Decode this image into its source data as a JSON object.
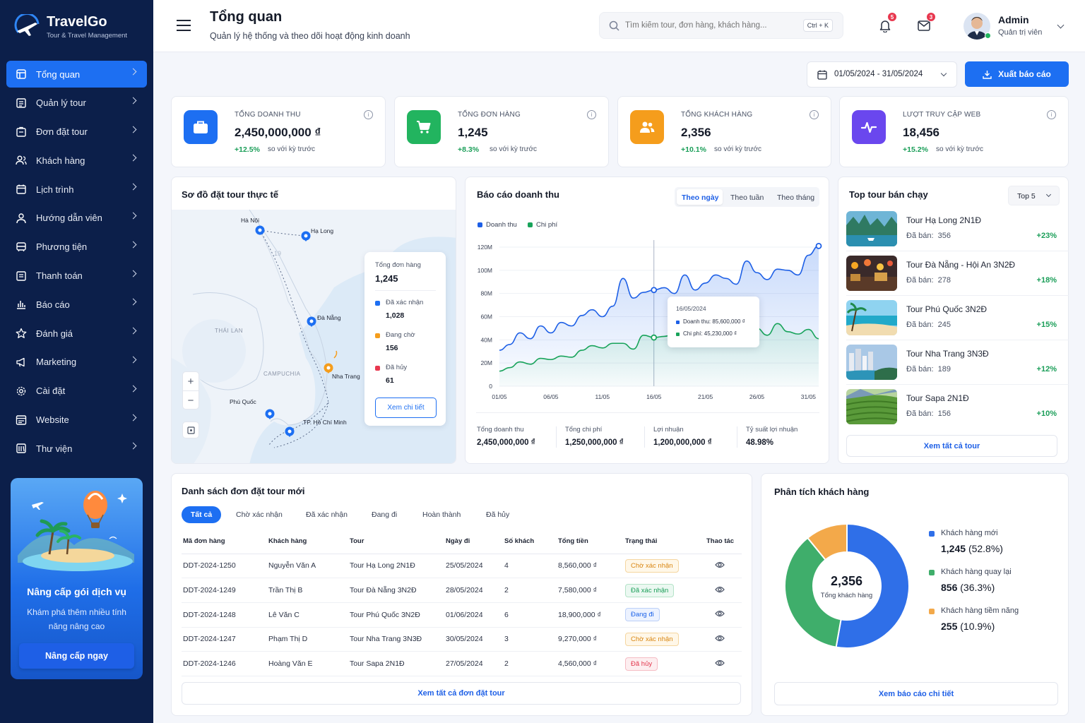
{
  "app": {
    "name": "TravelGo",
    "subtitle": "Tour & Travel Management"
  },
  "sidebar": {
    "items": [
      {
        "label": "Tổng quan",
        "icon": "dashboard-icon"
      },
      {
        "label": "Quản lý tour",
        "icon": "tour-list-icon"
      },
      {
        "label": "Đơn đặt tour",
        "icon": "booking-icon"
      },
      {
        "label": "Khách hàng",
        "icon": "customers-icon"
      },
      {
        "label": "Lịch trình",
        "icon": "calendar-icon"
      },
      {
        "label": "Hướng dẫn viên",
        "icon": "guide-icon"
      },
      {
        "label": "Phương tiện",
        "icon": "bus-icon"
      },
      {
        "label": "Thanh toán",
        "icon": "payment-icon"
      },
      {
        "label": "Báo cáo",
        "icon": "report-icon"
      },
      {
        "label": "Đánh giá",
        "icon": "star-icon"
      },
      {
        "label": "Marketing",
        "icon": "megaphone-icon"
      },
      {
        "label": "Cài đặt",
        "icon": "gear-icon"
      },
      {
        "label": "Website",
        "icon": "website-icon"
      },
      {
        "label": "Thư viện",
        "icon": "library-icon"
      }
    ],
    "promo": {
      "title": "Nâng cấp gói dịch vụ",
      "text": "Khám phá thêm nhiều tính năng nâng cao",
      "button": "Nâng cấp ngay"
    }
  },
  "header": {
    "title": "Tổng quan",
    "subtitle": "Quản lý hệ thống và theo dõi hoạt động kinh doanh",
    "search_placeholder": "Tìm kiếm tour, đơn hàng, khách hàng...",
    "shortcut": "Ctrl + K",
    "notif_count": "5",
    "mail_count": "3",
    "user_name": "Admin",
    "user_role": "Quản trị viên"
  },
  "toolbar": {
    "date_range": "01/05/2024 - 31/05/2024",
    "export_label": "Xuất báo cáo"
  },
  "stats": [
    {
      "label": "TỔNG DOANH THU",
      "value": "2,450,000,000 ₫",
      "change": "+12.5%",
      "note": "so với kỳ trước",
      "color": "#1d6ff2"
    },
    {
      "label": "TỔNG ĐƠN HÀNG",
      "value": "1,245",
      "change": "+8.3%",
      "note": "so với kỳ trước",
      "color": "#22b45f"
    },
    {
      "label": "TỔNG KHÁCH HÀNG",
      "value": "2,356",
      "change": "+10.1%",
      "note": "so với kỳ trước",
      "color": "#f59d1c"
    },
    {
      "label": "LƯỢT TRUY CẬP WEB",
      "value": "18,456",
      "change": "+15.2%",
      "note": "so với kỳ trước",
      "color": "#6a47ee"
    }
  ],
  "map": {
    "title": "Sơ đồ đặt tour thực tế",
    "places": {
      "hanoi": "Hà Nội",
      "halong": "Hạ Long",
      "danang": "Đà Nẵng",
      "nhatrang": "Nha Trang",
      "phuquoc": "Phú Quốc",
      "hcm": "TP. Hồ Chí Minh",
      "thailan": "THÁI LAN",
      "campuchia": "CAMPUCHIA"
    },
    "summary": {
      "total_label": "Tổng đơn hàng",
      "total": "1,245",
      "items": [
        {
          "label": "Đã xác nhận",
          "value": "1,028",
          "color": "#1d6ff2"
        },
        {
          "label": "Đang chờ",
          "value": "156",
          "color": "#f59d1c"
        },
        {
          "label": "Đã hủy",
          "value": "61",
          "color": "#e8384f"
        }
      ],
      "button": "Xem chi tiết"
    }
  },
  "revenue": {
    "title": "Báo cáo doanh thu",
    "tabs": [
      "Theo ngày",
      "Theo tuần",
      "Theo tháng"
    ],
    "legend": [
      "Doanh thu",
      "Chi phí"
    ],
    "tooltip": {
      "date": "16/05/2024",
      "revenue": "Doanh thu: 85,600,000 ₫",
      "cost": "Chi phí: 45,230,000 ₫"
    },
    "totals": [
      {
        "label": "Tổng doanh thu",
        "value": "2,450,000,000 ₫"
      },
      {
        "label": "Tổng chi phí",
        "value": "1,250,000,000 ₫"
      },
      {
        "label": "Lợi nhuận",
        "value": "1,200,000,000 ₫"
      },
      {
        "label": "Tỷ suất lợi nhuận",
        "value": "48.98%"
      }
    ]
  },
  "chart_data": {
    "type": "area",
    "ylabels": [
      "120M",
      "100M",
      "80M",
      "60M",
      "40M",
      "20M",
      "0"
    ],
    "xlabels": [
      "01/05",
      "06/05",
      "11/05",
      "16/05",
      "21/05",
      "26/05",
      "31/05"
    ],
    "ylim": [
      0,
      120
    ],
    "series": [
      {
        "name": "Doanh thu",
        "color": "#1d5fe6",
        "values": [
          31,
          36,
          46,
          41,
          52,
          46,
          55,
          52,
          61,
          66,
          60,
          69,
          93,
          76,
          81,
          83,
          85,
          80,
          96,
          83,
          89,
          96,
          93,
          88,
          108,
          98,
          92,
          101,
          100,
          96,
          113,
          121
        ]
      },
      {
        "name": "Chi phí",
        "color": "#18a35a",
        "values": [
          13,
          16,
          21,
          19,
          24,
          23,
          26,
          25,
          31,
          35,
          33,
          37,
          37,
          32,
          44,
          42,
          43,
          45,
          50,
          44,
          43,
          43,
          46,
          48,
          47,
          50,
          44,
          54,
          47,
          45,
          49,
          41
        ]
      }
    ]
  },
  "top_tours": {
    "title": "Top tour bán chạy",
    "filter": "Top 5",
    "sold_label": "Đã bán:",
    "items": [
      {
        "name": "Tour Hạ Long 2N1Đ",
        "sold": "356",
        "pct": "+23%"
      },
      {
        "name": "Tour Đà Nẵng - Hội An 3N2Đ",
        "sold": "278",
        "pct": "+18%"
      },
      {
        "name": "Tour Phú Quốc 3N2Đ",
        "sold": "245",
        "pct": "+15%"
      },
      {
        "name": "Tour Nha Trang 3N3Đ",
        "sold": "189",
        "pct": "+12%"
      },
      {
        "name": "Tour Sapa 2N1Đ",
        "sold": "156",
        "pct": "+10%"
      }
    ],
    "button": "Xem tất cả tour"
  },
  "orders": {
    "title": "Danh sách đơn đặt tour mới",
    "tabs": [
      "Tất cả",
      "Chờ xác nhận",
      "Đã xác nhận",
      "Đang đi",
      "Hoàn thành",
      "Đã hủy"
    ],
    "columns": [
      "Mã đơn hàng",
      "Khách hàng",
      "Tour",
      "Ngày đi",
      "Số khách",
      "Tổng tiền",
      "Trạng thái",
      "Thao tác"
    ],
    "rows": [
      {
        "id": "DDT-2024-1250",
        "customer": "Nguyễn Văn A",
        "tour": "Tour Hạ Long 2N1Đ",
        "date": "25/05/2024",
        "guests": "4",
        "total": "8,560,000 ₫",
        "status": "Chờ xác nhận",
        "cls": "p-wait"
      },
      {
        "id": "DDT-2024-1249",
        "customer": "Trần Thị B",
        "tour": "Tour Đà Nẵng 3N2Đ",
        "date": "28/05/2024",
        "guests": "2",
        "total": "7,580,000 ₫",
        "status": "Đã xác nhận",
        "cls": "p-ok"
      },
      {
        "id": "DDT-2024-1248",
        "customer": "Lê Văn C",
        "tour": "Tour Phú Quốc 3N2Đ",
        "date": "01/06/2024",
        "guests": "6",
        "total": "18,900,000 ₫",
        "status": "Đang đi",
        "cls": "p-go"
      },
      {
        "id": "DDT-2024-1247",
        "customer": "Phạm Thị D",
        "tour": "Tour Nha Trang 3N3Đ",
        "date": "30/05/2024",
        "guests": "3",
        "total": "9,270,000 ₫",
        "status": "Chờ xác nhận",
        "cls": "p-wait"
      },
      {
        "id": "DDT-2024-1246",
        "customer": "Hoàng Văn E",
        "tour": "Tour Sapa 2N1Đ",
        "date": "27/05/2024",
        "guests": "2",
        "total": "4,560,000 ₫",
        "status": "Đã hủy",
        "cls": "p-cancel"
      }
    ],
    "button": "Xem tất cả đơn đặt tour"
  },
  "customers": {
    "title": "Phân tích khách hàng",
    "total": "2,356",
    "total_label": "Tổng khách hàng",
    "segments": [
      {
        "label": "Khách hàng mới",
        "value": "1,245",
        "pct": "(52.8%)",
        "share": 52.8,
        "color": "#2f6fe8"
      },
      {
        "label": "Khách hàng quay lại",
        "value": "856",
        "pct": "(36.3%)",
        "share": 36.3,
        "color": "#3fae6b"
      },
      {
        "label": "Khách hàng tiềm năng",
        "value": "255",
        "pct": "(10.9%)",
        "share": 10.9,
        "color": "#f3a94a"
      }
    ],
    "button": "Xem báo cáo chi tiết"
  }
}
